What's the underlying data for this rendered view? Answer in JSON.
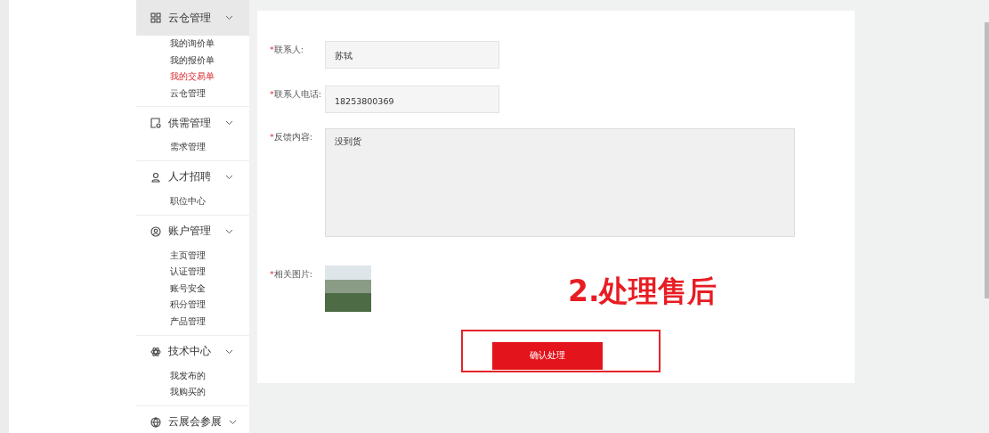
{
  "sidebar": {
    "groups": [
      {
        "title": "云仓管理",
        "selected": true,
        "items": [
          {
            "label": "我的询价单",
            "selected": false
          },
          {
            "label": "我的报价单",
            "selected": false
          },
          {
            "label": "我的交易单",
            "selected": true
          },
          {
            "label": "云仓管理",
            "selected": false
          }
        ]
      },
      {
        "title": "供需管理",
        "selected": false,
        "items": [
          {
            "label": "需求管理",
            "selected": false
          }
        ]
      },
      {
        "title": "人才招聘",
        "selected": false,
        "items": [
          {
            "label": "职位中心",
            "selected": false
          }
        ]
      },
      {
        "title": "账户管理",
        "selected": false,
        "items": [
          {
            "label": "主页管理",
            "selected": false
          },
          {
            "label": "认证管理",
            "selected": false
          },
          {
            "label": "账号安全",
            "selected": false
          },
          {
            "label": "积分管理",
            "selected": false
          },
          {
            "label": "产品管理",
            "selected": false
          }
        ]
      },
      {
        "title": "技术中心",
        "selected": false,
        "items": [
          {
            "label": "我发布的",
            "selected": false
          },
          {
            "label": "我购买的",
            "selected": false
          }
        ]
      },
      {
        "title": "云展会参展",
        "selected": false
      }
    ]
  },
  "form": {
    "fields": [
      {
        "kind": "input",
        "required_mark": "*",
        "label": "联系人:",
        "value": "苏轼"
      },
      {
        "kind": "input",
        "required_mark": "*",
        "label": "联系人电话:",
        "value": "18253800369"
      },
      {
        "kind": "textarea",
        "required_mark": "*",
        "label": "反馈内容:",
        "value": "没到货"
      },
      {
        "kind": "image",
        "required_mark": "*",
        "label": "相关图片:"
      }
    ],
    "submit_button": "确认处理"
  },
  "annotation": {
    "text": "2.处理售后"
  }
}
